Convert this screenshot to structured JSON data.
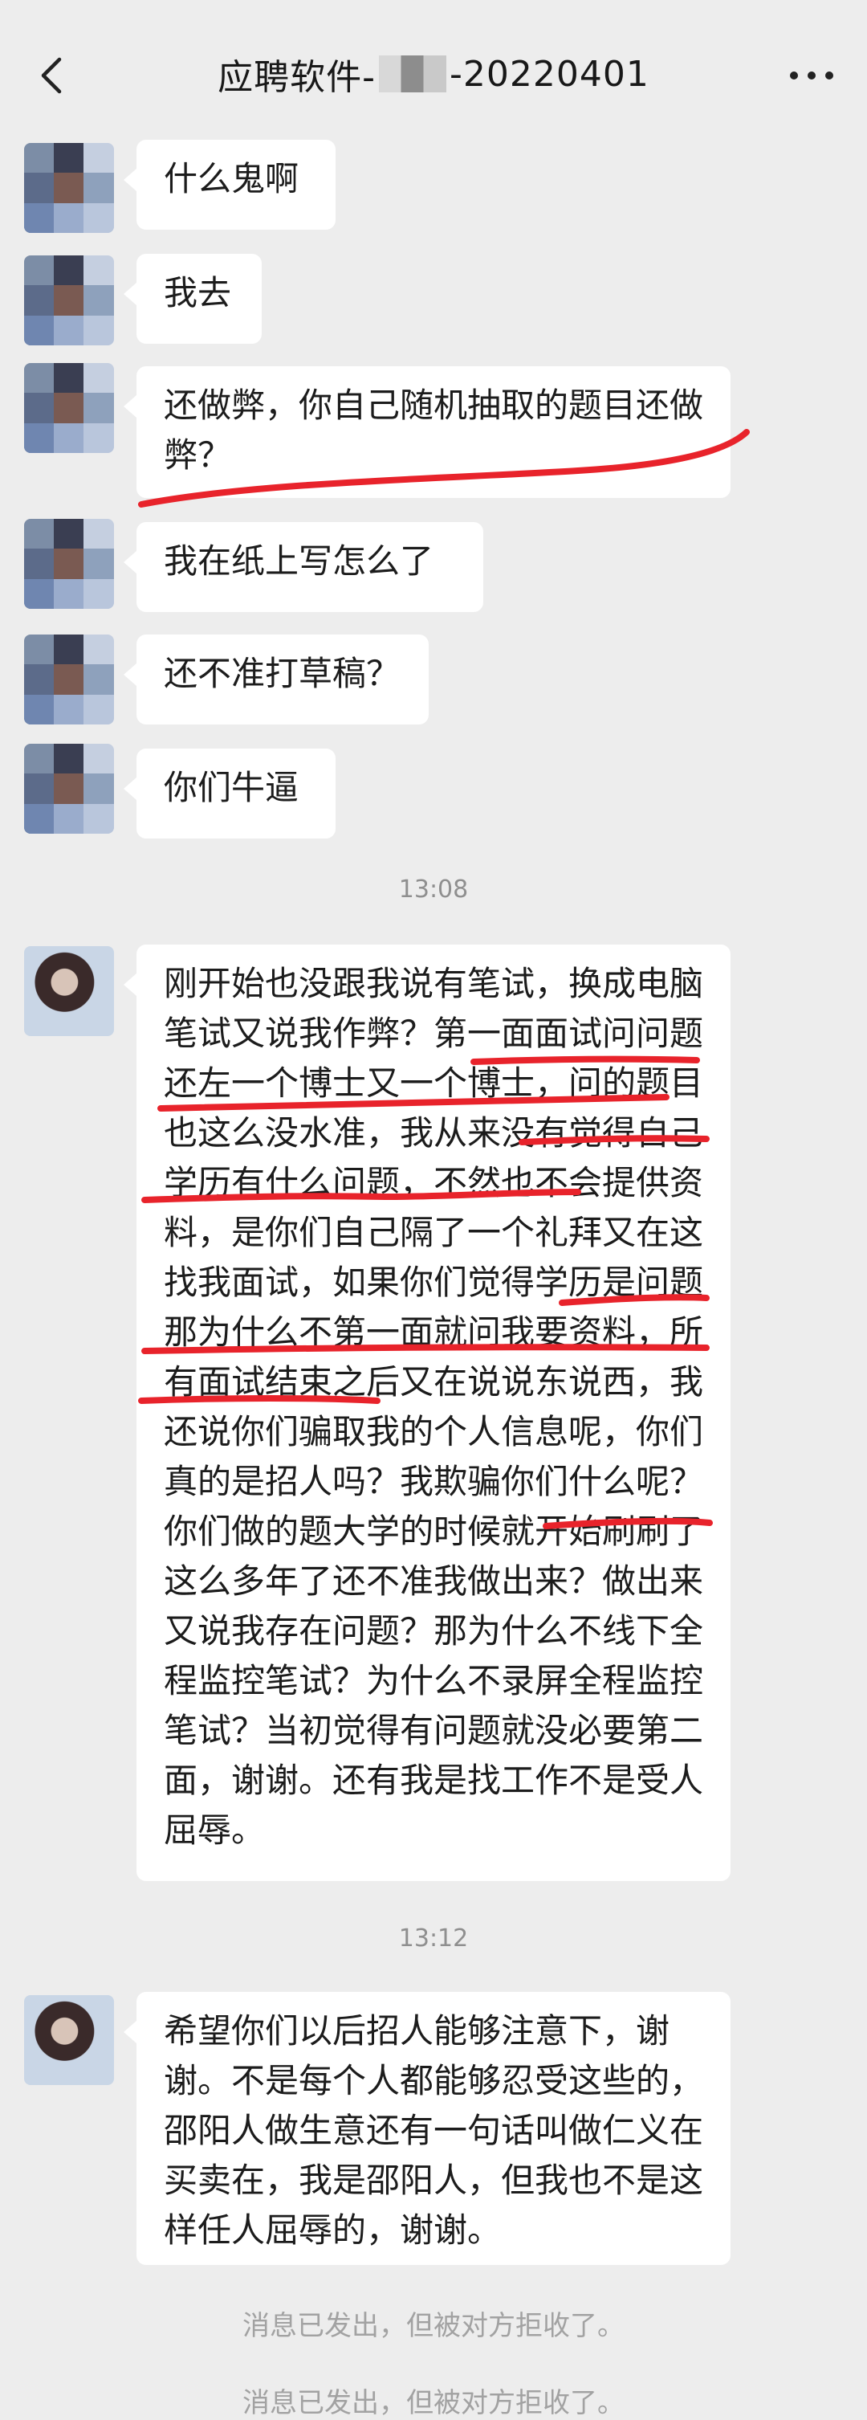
{
  "header": {
    "title_prefix": "应聘软件-",
    "title_suffix": "-20220401"
  },
  "messages": [
    {
      "text": "什么鬼啊"
    },
    {
      "text": "我去"
    },
    {
      "text": "还做弊，你自己随机抽取的题目还做弊？"
    },
    {
      "text": "我在纸上写怎么了"
    },
    {
      "text": "还不准打草稿？"
    },
    {
      "text": "你们牛逼"
    },
    {
      "text": "刚开始也没跟我说有笔试，换成电脑笔试又说我作弊？第一面面试问问题还左一个博士又一个博士，问的题目也这么没水准，我从来没有觉得自己学历有什么问题，不然也不会提供资料，是你们自己隔了一个礼拜又在这找我面试，如果你们觉得学历是问题那为什么不第一面就问我要资料，所有面试结束之后又在说说东说西，我还说你们骗取我的个人信息呢，你们真的是招人吗？我欺骗你们什么呢？你们做的题大学的时候就开始刷刷了这么多年了还不准我做出来？做出来又说我存在问题？那为什么不线下全程监控笔试？为什么不录屏全程监控笔试？当初觉得有问题就没必要第二面，谢谢。还有我是找工作不是受人屈辱。"
    },
    {
      "text": "希望你们以后招人能够注意下，谢谢。不是每个人都能够忍受这些的，邵阳人做生意还有一句话叫做仁义在买卖在，我是邵阳人，但我也不是这样任人屈辱的，谢谢。"
    }
  ],
  "timestamps": [
    "13:08",
    "13:12"
  ],
  "system_notices": [
    "消息已发出，但被对方拒收了。",
    "消息已发出，但被对方拒收了。"
  ],
  "colors": {
    "annotation": "#e8232b",
    "background": "#ededed",
    "bubble": "#ffffff"
  },
  "icons": {
    "back": "chevron-left-icon",
    "more": "more-dots-icon"
  }
}
